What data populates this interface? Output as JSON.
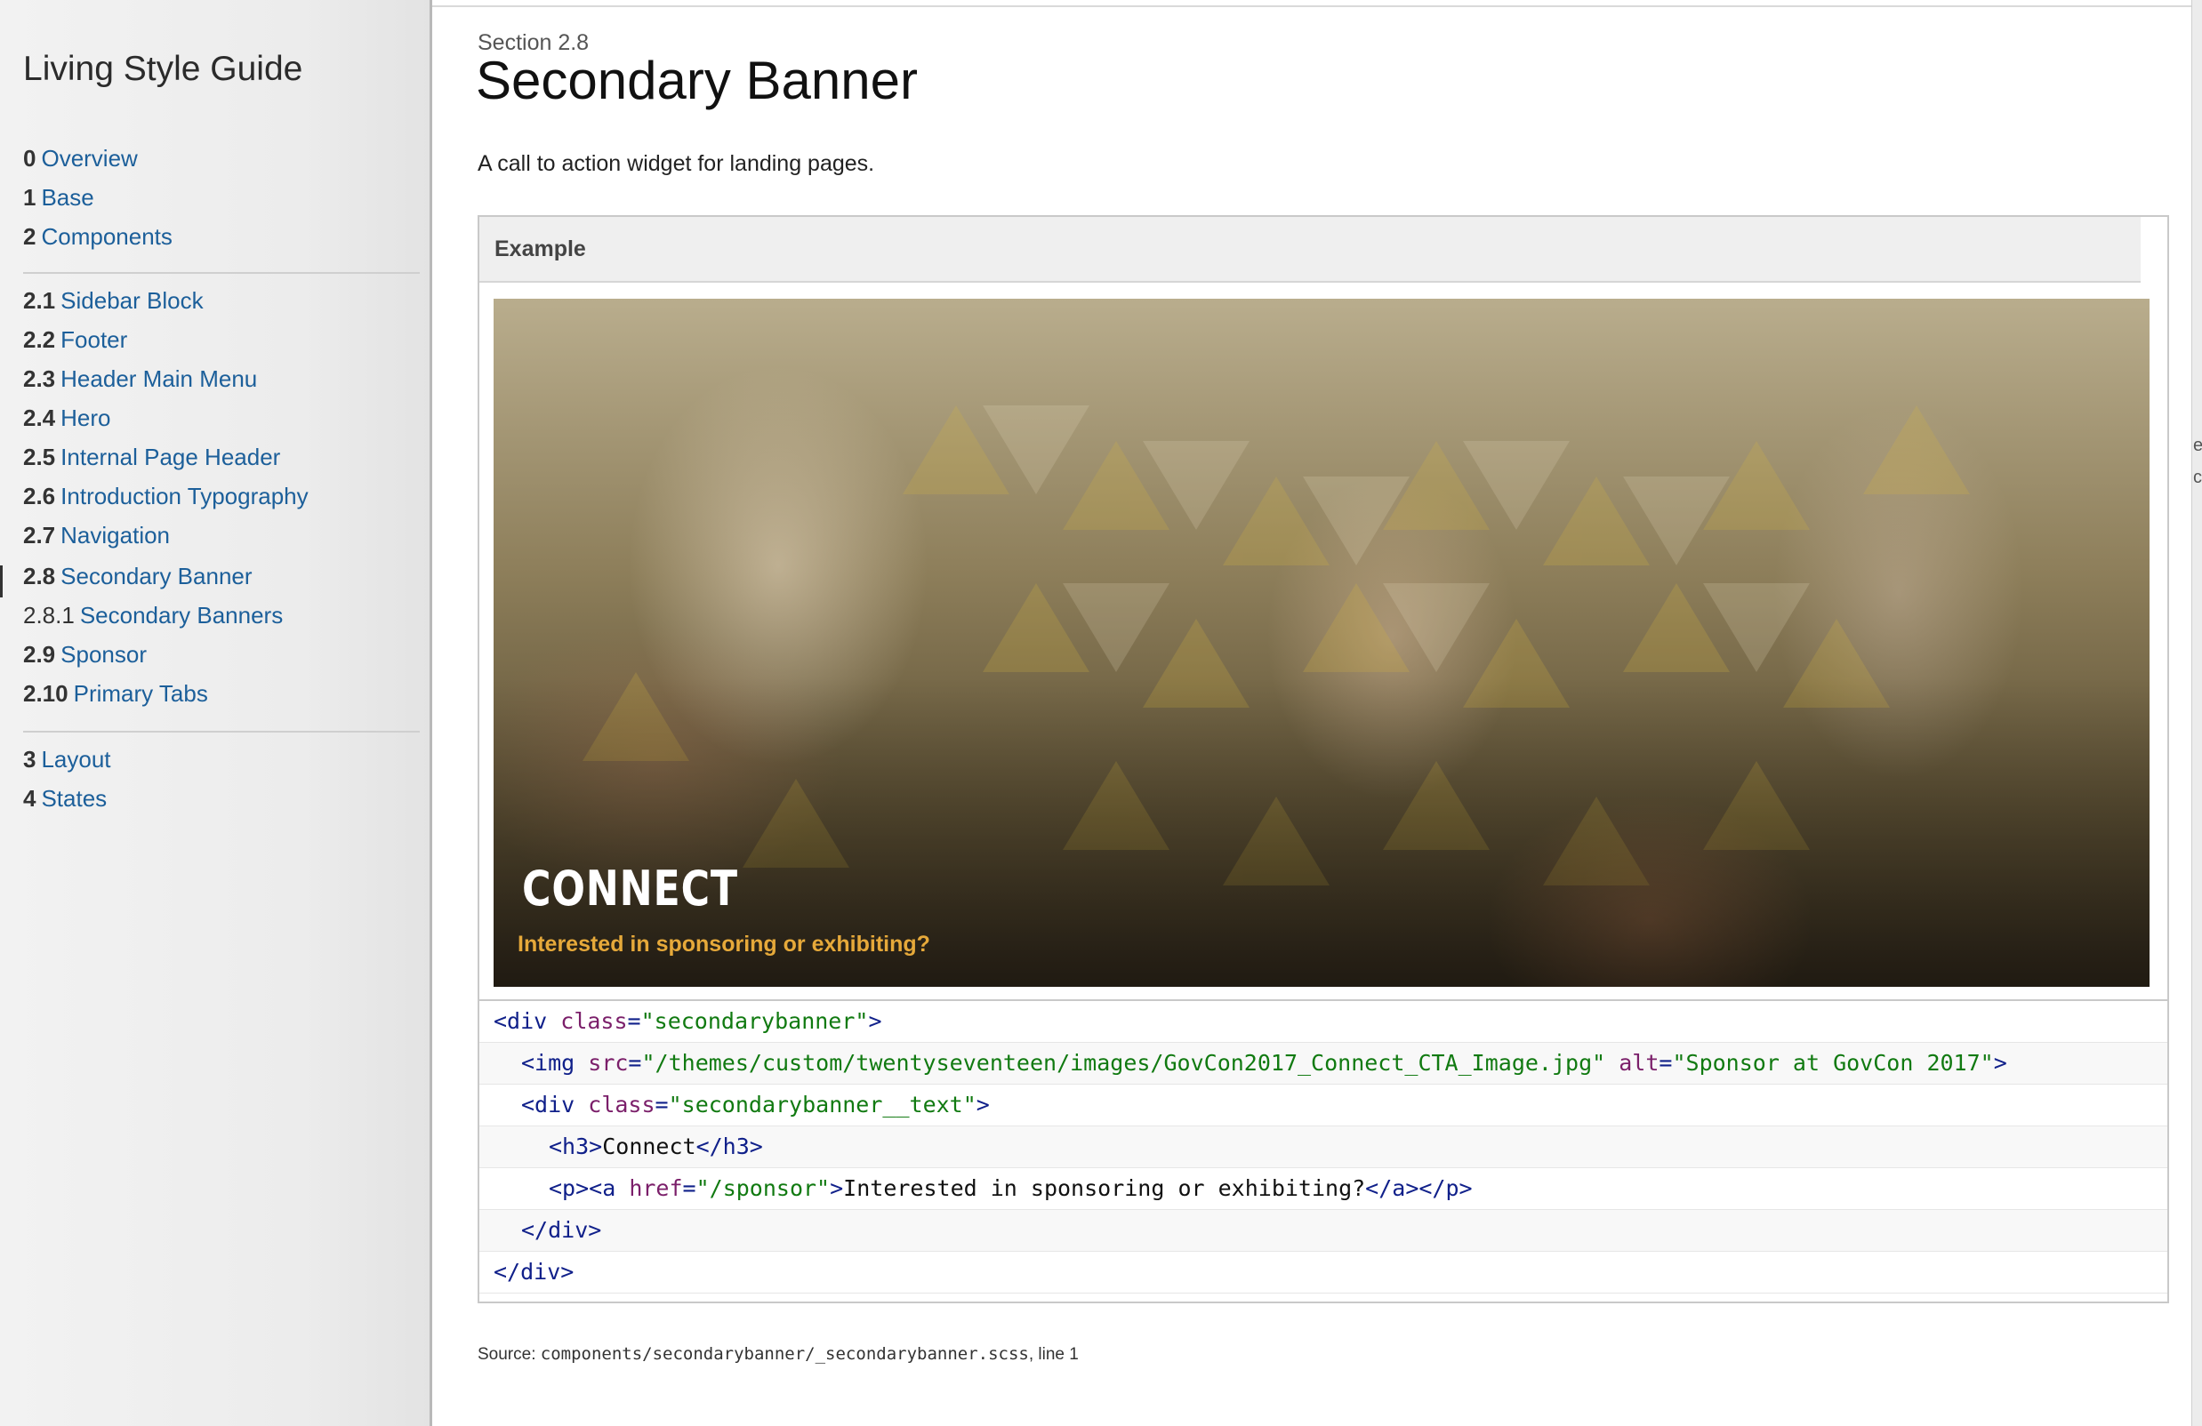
{
  "sidebar": {
    "brand": "Living Style Guide",
    "items": [
      {
        "num": "0",
        "label": "Overview"
      },
      {
        "num": "1",
        "label": "Base"
      },
      {
        "num": "2",
        "label": "Components"
      },
      {
        "num": "2.1",
        "label": "Sidebar Block"
      },
      {
        "num": "2.2",
        "label": "Footer"
      },
      {
        "num": "2.3",
        "label": "Header Main Menu"
      },
      {
        "num": "2.4",
        "label": "Hero"
      },
      {
        "num": "2.5",
        "label": "Internal Page Header"
      },
      {
        "num": "2.6",
        "label": "Introduction Typography"
      },
      {
        "num": "2.7",
        "label": "Navigation"
      },
      {
        "num": "2.8",
        "label": "Secondary Banner"
      },
      {
        "num": "2.8.1",
        "label": "Secondary Banners"
      },
      {
        "num": "2.9",
        "label": "Sponsor"
      },
      {
        "num": "2.10",
        "label": "Primary Tabs"
      },
      {
        "num": "3",
        "label": "Layout"
      },
      {
        "num": "4",
        "label": "States"
      }
    ]
  },
  "section": {
    "number": "Section 2.8",
    "title": "Secondary Banner",
    "description": "A call to action widget for landing pages."
  },
  "example": {
    "label": "Example",
    "banner_title": "CONNECT",
    "banner_subtitle": "Interested in sponsoring or exhibiting?"
  },
  "code": {
    "l1_open": "<div ",
    "l1_attr": "class",
    "l1_eq": "=",
    "l1_val": "\"secondarybanner\"",
    "l1_close": ">",
    "l2_open": "<img ",
    "l2_attr1": "src",
    "l2_val1": "\"/themes/custom/twentyseventeen/images/GovCon2017_Connect_CTA_Image.jpg\"",
    "l2_attr2": "alt",
    "l2_val2": "\"Sponsor at GovCon 2017\"",
    "l2_close": ">",
    "l3_open": "<div ",
    "l3_attr": "class",
    "l3_val": "\"secondarybanner__text\"",
    "l3_close": ">",
    "l4_open": "<h3>",
    "l4_text": "Connect",
    "l4_close": "</h3>",
    "l5_open": "<p><a ",
    "l5_attr": "href",
    "l5_val": "\"/sponsor\"",
    "l5_gt": ">",
    "l5_text": "Interested in sponsoring or exhibiting?",
    "l5_close": "</a></p>",
    "l6": "</div>",
    "l7": "</div>"
  },
  "source": {
    "prefix": "Source: ",
    "path": "components/secondarybanner/_secondarybanner.scss",
    "suffix": ", line 1"
  },
  "edge": {
    "glyph1": "e",
    "glyph2": "c"
  },
  "colors": {
    "link": "#1c5f9a",
    "banner_subtitle": "#e6a93a",
    "code_tag": "#10208a",
    "code_attr": "#7b1f6a",
    "code_string": "#117a11"
  }
}
